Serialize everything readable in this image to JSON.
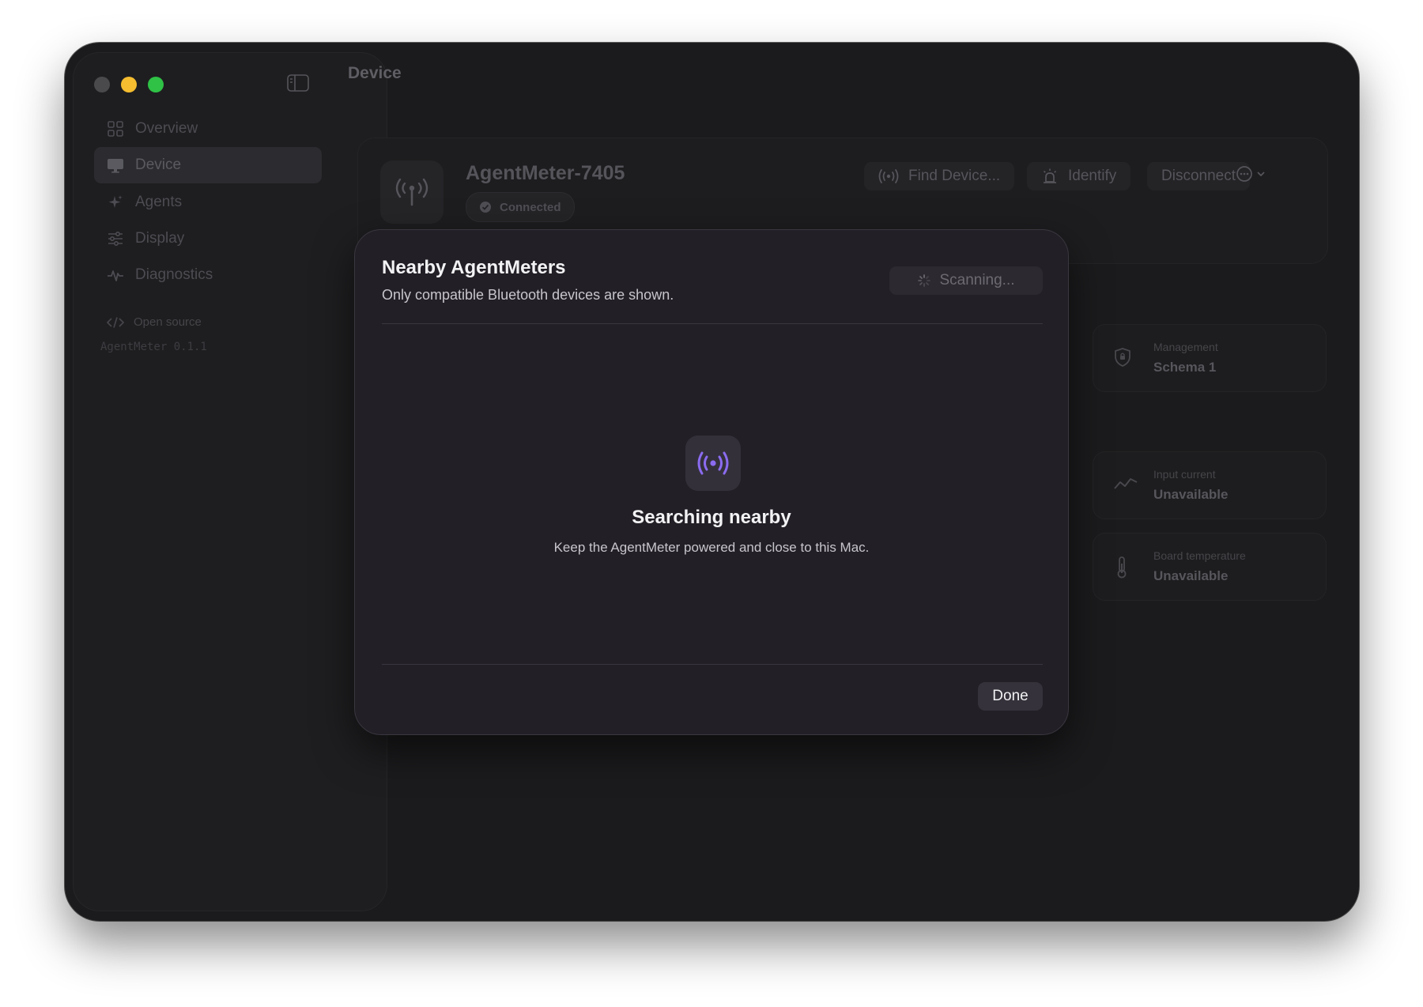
{
  "window": {
    "title": "Device"
  },
  "sidebar": {
    "items": [
      {
        "label": "Overview",
        "icon": "grid-icon"
      },
      {
        "label": "Device",
        "icon": "monitor-icon",
        "active": true
      },
      {
        "label": "Agents",
        "icon": "sparkle-icon"
      },
      {
        "label": "Display",
        "icon": "sliders-icon"
      },
      {
        "label": "Diagnostics",
        "icon": "pulse-icon"
      }
    ],
    "open_source_label": "Open source",
    "version": "AgentMeter 0.1.1"
  },
  "device": {
    "name": "AgentMeter-7405",
    "status": "Connected",
    "actions": {
      "find": "Find Device...",
      "identify": "Identify",
      "disconnect": "Disconnect"
    }
  },
  "stats": [
    {
      "label": "Management",
      "value": "Schema 1",
      "icon": "shield-icon"
    },
    {
      "label": "Input current",
      "value": "Unavailable",
      "icon": "wave-icon"
    },
    {
      "label": "Board temperature",
      "value": "Unavailable",
      "icon": "thermometer-icon"
    }
  ],
  "modal": {
    "title": "Nearby AgentMeters",
    "subtitle": "Only compatible Bluetooth devices are shown.",
    "scan_label": "Scanning...",
    "empty_title": "Searching nearby",
    "empty_subtitle": "Keep the AgentMeter powered and close to this Mac.",
    "done_label": "Done"
  },
  "colors": {
    "accent": "#8b6cf0",
    "minimize": "#f5bd2f",
    "maximize": "#2fc246",
    "modal_bg": "#231f26"
  }
}
